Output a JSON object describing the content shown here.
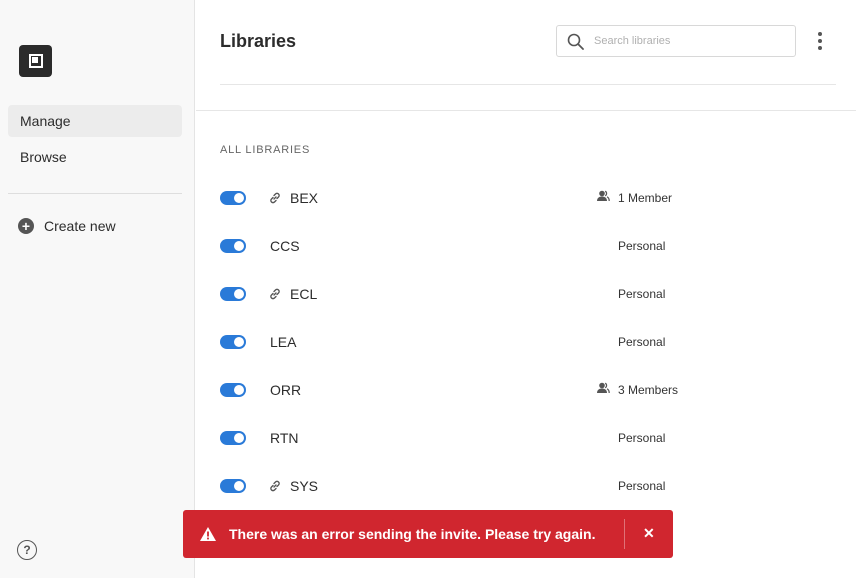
{
  "window": {
    "close_color": "#ee5a52"
  },
  "sidebar": {
    "logo_icon": "app-logo-icon",
    "nav": [
      {
        "label": "Manage",
        "active": true
      },
      {
        "label": "Browse",
        "active": false
      }
    ],
    "create_new_label": "Create new",
    "help_glyph": "?"
  },
  "header": {
    "title": "Libraries",
    "search_placeholder": "Search libraries"
  },
  "section_label": "ALL LIBRARIES",
  "libraries": [
    {
      "name": "BEX",
      "linked": true,
      "meta": "1 Member",
      "members_icon": true,
      "enabled": true
    },
    {
      "name": "CCS",
      "linked": false,
      "meta": "Personal",
      "members_icon": false,
      "enabled": true
    },
    {
      "name": "ECL",
      "linked": true,
      "meta": "Personal",
      "members_icon": false,
      "enabled": true
    },
    {
      "name": "LEA",
      "linked": false,
      "meta": "Personal",
      "members_icon": false,
      "enabled": true
    },
    {
      "name": "ORR",
      "linked": false,
      "meta": "3 Members",
      "members_icon": true,
      "enabled": true
    },
    {
      "name": "RTN",
      "linked": false,
      "meta": "Personal",
      "members_icon": false,
      "enabled": true
    },
    {
      "name": "SYS",
      "linked": true,
      "meta": "Personal",
      "members_icon": false,
      "enabled": true
    }
  ],
  "toast": {
    "message": "There was an error sending the invite. Please try again.",
    "close_glyph": "✕",
    "color": "#d0262f"
  },
  "colors": {
    "accent": "#2a7ad8"
  }
}
